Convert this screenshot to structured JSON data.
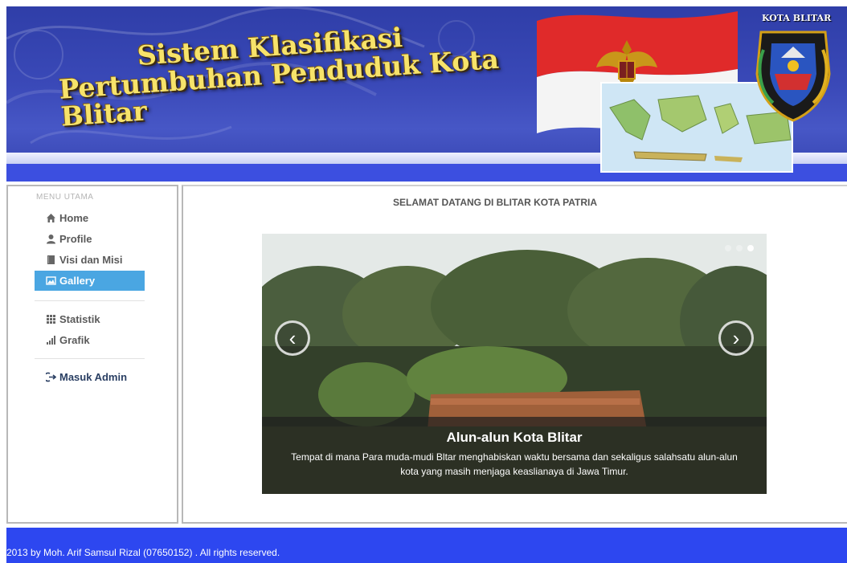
{
  "header": {
    "title_line1": "Sistem Klasifikasi",
    "title_line2": "Pertumbuhan Penduduk Kota Blitar",
    "city_label": "KOTA BLITAR"
  },
  "sidebar": {
    "heading": "MENU UTAMA",
    "items": [
      {
        "label": "Home",
        "icon": "home-icon"
      },
      {
        "label": "Profile",
        "icon": "user-icon"
      },
      {
        "label": "Visi dan Misi",
        "icon": "book-icon"
      },
      {
        "label": "Gallery",
        "icon": "picture-icon",
        "active": true
      },
      {
        "label": "Statistik",
        "icon": "grid-icon"
      },
      {
        "label": "Grafik",
        "icon": "bar-chart-icon"
      },
      {
        "label": "Masuk Admin",
        "icon": "login-icon"
      }
    ]
  },
  "main": {
    "welcome": "SELAMAT DATANG DI BLITAR KOTA PATRIA",
    "carousel": {
      "caption_title": "Alun-alun Kota Blitar",
      "caption_text": "Tempat di mana Para muda-mudi Bltar menghabiskan waktu bersama dan sekaligus salahsatu alun-alun kota yang masih menjaga keaslianaya di Jawa Timur.",
      "slide_count": 3,
      "active_slide": 3
    }
  },
  "footer": {
    "text": "2013 by Moh. Arif Samsul Rizal (07650152) . All rights reserved."
  },
  "colors": {
    "banner_blue": "#3a49b8",
    "active_menu": "#4aa6e2",
    "footer_blue": "#2d47f0",
    "title_gold": "#f7e36a"
  }
}
